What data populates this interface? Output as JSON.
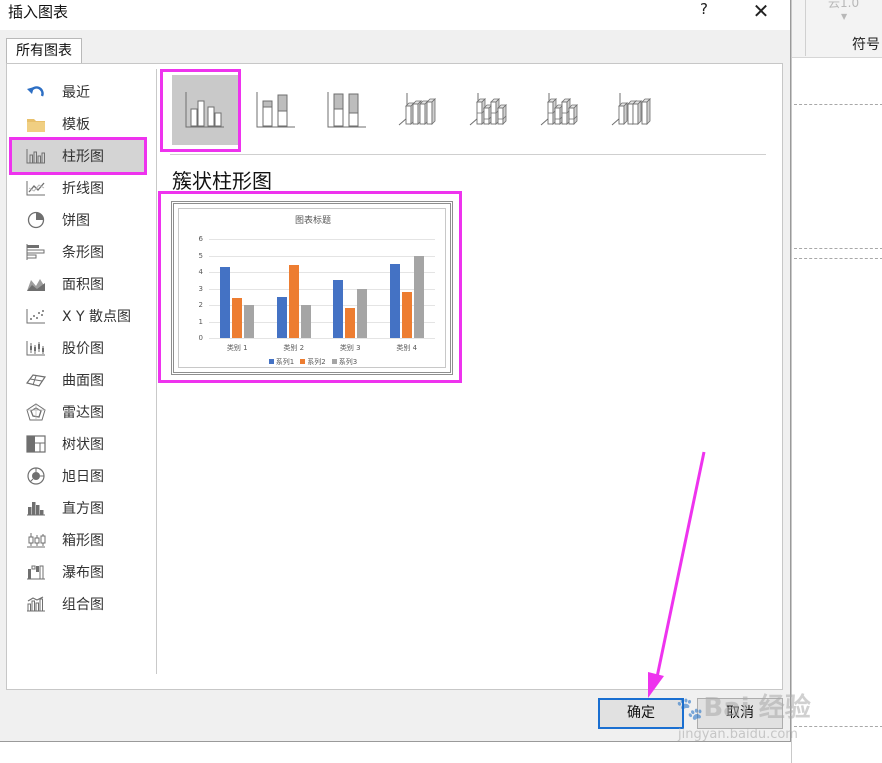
{
  "dialog": {
    "title": "插入图表",
    "help_label": "?",
    "close_label": "✕",
    "tab_label": "所有图表",
    "ok_label": "确定",
    "cancel_label": "取消"
  },
  "background_window": {
    "ghost_text": "云1.0",
    "symbol_label": "符号"
  },
  "sidebar": {
    "items": [
      {
        "label": "最近",
        "icon": "undo-arrow-icon"
      },
      {
        "label": "模板",
        "icon": "folder-icon"
      },
      {
        "label": "柱形图",
        "icon": "column-chart-icon",
        "selected": true
      },
      {
        "label": "折线图",
        "icon": "line-chart-icon"
      },
      {
        "label": "饼图",
        "icon": "pie-chart-icon"
      },
      {
        "label": "条形图",
        "icon": "bar-chart-icon"
      },
      {
        "label": "面积图",
        "icon": "area-chart-icon"
      },
      {
        "label": "X Y 散点图",
        "icon": "scatter-chart-icon"
      },
      {
        "label": "股价图",
        "icon": "stock-chart-icon"
      },
      {
        "label": "曲面图",
        "icon": "surface-chart-icon"
      },
      {
        "label": "雷达图",
        "icon": "radar-chart-icon"
      },
      {
        "label": "树状图",
        "icon": "treemap-chart-icon"
      },
      {
        "label": "旭日图",
        "icon": "sunburst-chart-icon"
      },
      {
        "label": "直方图",
        "icon": "histogram-chart-icon"
      },
      {
        "label": "箱形图",
        "icon": "box-whisker-chart-icon"
      },
      {
        "label": "瀑布图",
        "icon": "waterfall-chart-icon"
      },
      {
        "label": "组合图",
        "icon": "combo-chart-icon"
      }
    ]
  },
  "subtypes": {
    "selected_title": "簇状柱形图",
    "items": [
      {
        "icon": "clustered-column-icon",
        "selected": true
      },
      {
        "icon": "stacked-column-icon"
      },
      {
        "icon": "100-percent-stacked-column-icon"
      },
      {
        "icon": "3d-clustered-column-icon"
      },
      {
        "icon": "3d-stacked-column-icon"
      },
      {
        "icon": "3d-100-percent-stacked-column-icon"
      },
      {
        "icon": "3d-column-icon"
      }
    ]
  },
  "chart_data": {
    "type": "bar",
    "title": "图表标题",
    "categories": [
      "类别 1",
      "类别 2",
      "类别 3",
      "类别 4"
    ],
    "series": [
      {
        "name": "系列1",
        "values": [
          4.3,
          2.5,
          3.5,
          4.5
        ],
        "color": "#4472c4"
      },
      {
        "name": "系列2",
        "values": [
          2.4,
          4.4,
          1.8,
          2.8
        ],
        "color": "#ed7d31"
      },
      {
        "name": "系列3",
        "values": [
          2.0,
          2.0,
          3.0,
          5.0
        ],
        "color": "#a5a5a5"
      }
    ],
    "y_ticks": [
      "0",
      "1",
      "2",
      "3",
      "4",
      "5",
      "6"
    ],
    "ylim": [
      0,
      6
    ],
    "grid": true,
    "legend_position": "bottom"
  },
  "annotation_color": "#ee33ee",
  "watermark": {
    "logo_text": "Bai 经验",
    "url_text": "jingyan.baidu.com"
  }
}
